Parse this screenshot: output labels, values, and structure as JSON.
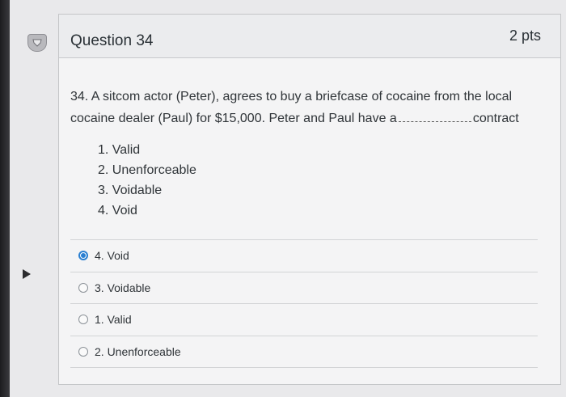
{
  "question": {
    "title": "Question 34",
    "points": "2 pts",
    "text_before": "34. A sitcom actor (Peter), agrees to buy a briefcase of cocaine from the local cocaine dealer (Paul) for $15,000. Peter and Paul have a",
    "text_after": "contract",
    "options": [
      "1. Valid",
      "2. Unenforceable",
      "3. Voidable",
      "4. Void"
    ]
  },
  "answers": [
    {
      "label": "4. Void",
      "selected": true
    },
    {
      "label": "3. Voidable",
      "selected": false
    },
    {
      "label": "1. Valid",
      "selected": false
    },
    {
      "label": "2. Unenforceable",
      "selected": false
    }
  ],
  "colors": {
    "accent": "#2a7fd1",
    "card_bg": "#f4f4f5",
    "header_bg": "#ebecee"
  },
  "icons": {
    "flag": "flag-icon",
    "nav": "play-arrow-icon"
  }
}
